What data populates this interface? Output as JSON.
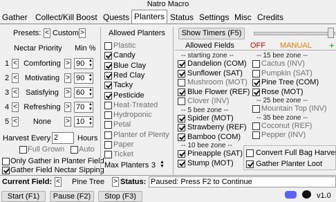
{
  "window": {
    "title": "Natro Macro"
  },
  "tabs": [
    "Gather",
    "Collect/Kill",
    "Boost",
    "Quests",
    "Planters",
    "Status",
    "Settings",
    "Misc",
    "Credits"
  ],
  "presets": {
    "label": "Presets:",
    "value": "Custom"
  },
  "nectar": {
    "header_priority": "Nectar Priority",
    "header_min": "Min %",
    "rows": [
      {
        "num": "1",
        "name": "Comforting",
        "min": "90"
      },
      {
        "num": "2",
        "name": "Motivating",
        "min": "90"
      },
      {
        "num": "3",
        "name": "Satisfying",
        "min": "60"
      },
      {
        "num": "4",
        "name": "Refreshing",
        "min": "70"
      },
      {
        "num": "5",
        "name": "None",
        "min": "10"
      }
    ]
  },
  "harvest": {
    "label": "Harvest Every",
    "value": "2",
    "unit": "Hours",
    "full_grown": "Full Grown",
    "auto": "Auto"
  },
  "options": {
    "only_gather": "Only Gather in Planter Field",
    "gather_nectar": "Gather Field Nectar Sipping"
  },
  "allowed_planters": {
    "header": "Allowed Planters",
    "items": [
      {
        "name": "Plastic",
        "checked": false
      },
      {
        "name": "Candy",
        "checked": true
      },
      {
        "name": "Blue Clay",
        "checked": true
      },
      {
        "name": "Red Clay",
        "checked": true
      },
      {
        "name": "Tacky",
        "checked": true
      },
      {
        "name": "Pesticide",
        "checked": true
      },
      {
        "name": "Heat-Treated",
        "checked": false
      },
      {
        "name": "Hydroponic",
        "checked": false
      },
      {
        "name": "Petal",
        "checked": false
      },
      {
        "name": "Planter of Plenty",
        "checked": false
      },
      {
        "name": "Paper",
        "checked": false
      },
      {
        "name": "Ticket",
        "checked": false
      }
    ],
    "max_label": "Max Planters",
    "max_value": "3"
  },
  "show_timers": {
    "label": "Show Timers (F5)"
  },
  "allowed_fields": {
    "header": "Allowed Fields",
    "off": "OFF",
    "manual": "MANUAL",
    "plus": "+",
    "zones_left": [
      {
        "zone": "-- starting zone --",
        "fields": [
          {
            "name": "Dandelion (COM)",
            "checked": true
          },
          {
            "name": "Sunflower (SAT)",
            "checked": true
          },
          {
            "name": "Mushroom (MOT)",
            "checked": false
          },
          {
            "name": "Blue Flower (REF)",
            "checked": true
          },
          {
            "name": "Clover (INV)",
            "checked": false
          }
        ]
      },
      {
        "zone": "-- 5 bee zone --",
        "fields": [
          {
            "name": "Spider (MOT)",
            "checked": true
          },
          {
            "name": "Strawberry (REF)",
            "checked": true
          },
          {
            "name": "Bamboo (COM)",
            "checked": true
          }
        ]
      },
      {
        "zone": "-- 10 bee zone --",
        "fields": [
          {
            "name": "Pineapple (SAT)",
            "checked": true
          },
          {
            "name": "Stump (MOT)",
            "checked": true
          }
        ]
      }
    ],
    "zones_right": [
      {
        "zone": "-- 15 bee zone --",
        "fields": [
          {
            "name": "Cactus (INV)",
            "checked": false
          },
          {
            "name": "Pumpkin (SAT)",
            "checked": false
          },
          {
            "name": "Pine Tree (COM)",
            "checked": true
          },
          {
            "name": "Rose (MOT)",
            "checked": true
          }
        ]
      },
      {
        "zone": "-- 25 bee zone --",
        "fields": [
          {
            "name": "Mountain Top (INV)",
            "checked": false
          }
        ]
      },
      {
        "zone": "-- 35 bee zone --",
        "fields": [
          {
            "name": "Coconut (REF)",
            "checked": false
          },
          {
            "name": "Pepper (INV)",
            "checked": false
          }
        ]
      }
    ]
  },
  "extra": {
    "convert_full": "Convert Full Bag Harvest",
    "gather_loot": "Gather Planter Loot"
  },
  "status_bar": {
    "current_field_label": "Current Field:",
    "current_field": "Pine Tree",
    "status_label": "Status:",
    "status": "Paused: Press F2 to Continue"
  },
  "bottom": {
    "start": "Start (F1)",
    "pause": "Pause (F2)",
    "stop": "Stop (F3)",
    "version": "v1.0"
  }
}
